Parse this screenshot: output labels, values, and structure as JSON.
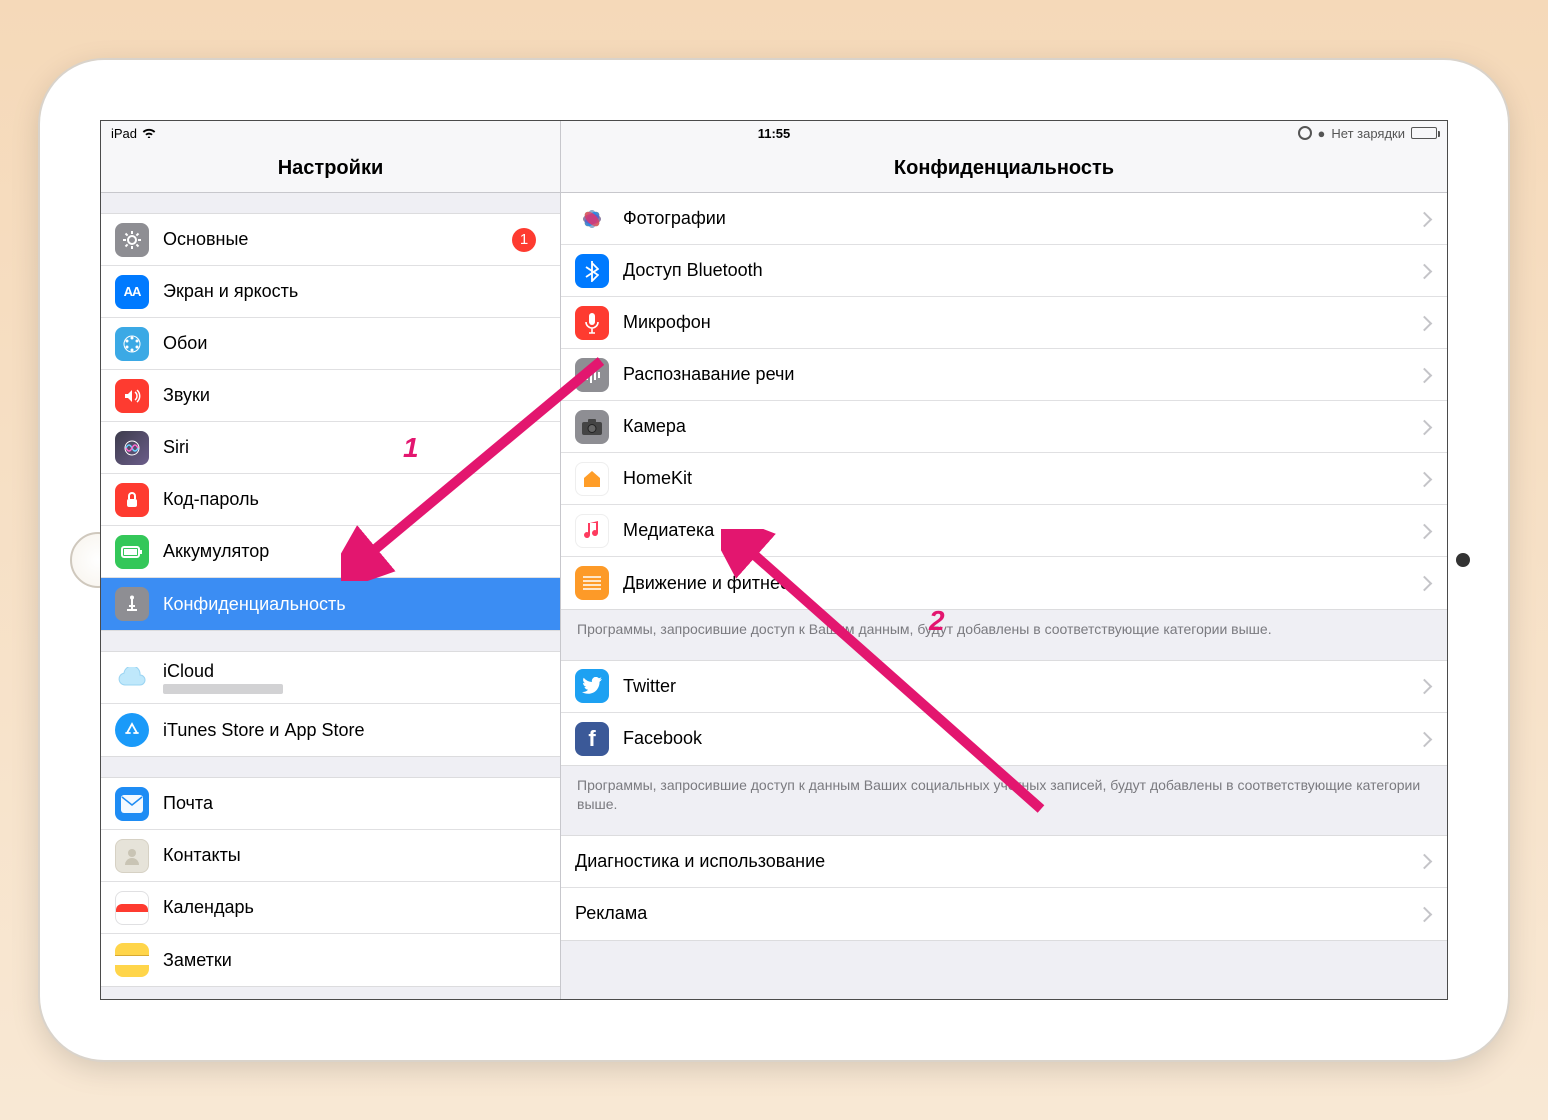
{
  "statusBar": {
    "device": "iPad",
    "time": "11:55",
    "chargingText": "Нет зарядки"
  },
  "sidebar": {
    "title": "Настройки",
    "groups": [
      {
        "items": [
          {
            "id": "general",
            "label": "Основные",
            "badge": "1"
          },
          {
            "id": "display",
            "label": "Экран и яркость"
          },
          {
            "id": "wallpaper",
            "label": "Обои"
          },
          {
            "id": "sounds",
            "label": "Звуки"
          },
          {
            "id": "siri",
            "label": "Siri"
          },
          {
            "id": "passcode",
            "label": "Код-пароль"
          },
          {
            "id": "battery",
            "label": "Аккумулятор"
          },
          {
            "id": "privacy",
            "label": "Конфиденциальность",
            "selected": true
          }
        ]
      },
      {
        "items": [
          {
            "id": "icloud",
            "label": "iCloud",
            "redacted": true
          },
          {
            "id": "appstore",
            "label": "iTunes Store и App Store"
          }
        ]
      },
      {
        "items": [
          {
            "id": "mail",
            "label": "Почта"
          },
          {
            "id": "contacts",
            "label": "Контакты"
          },
          {
            "id": "calendar",
            "label": "Календарь"
          },
          {
            "id": "notes",
            "label": "Заметки"
          }
        ]
      }
    ]
  },
  "detail": {
    "title": "Конфиденциальность",
    "groups": [
      {
        "flushTop": true,
        "items": [
          {
            "id": "photos",
            "label": "Фотографии"
          },
          {
            "id": "bluetooth",
            "label": "Доступ Bluetooth"
          },
          {
            "id": "mic",
            "label": "Микрофон"
          },
          {
            "id": "speech",
            "label": "Распознавание речи"
          },
          {
            "id": "camera",
            "label": "Камера"
          },
          {
            "id": "homekit",
            "label": "HomeKit"
          },
          {
            "id": "media",
            "label": "Медиатека"
          },
          {
            "id": "motion",
            "label": "Движение и фитнес"
          }
        ],
        "footer": "Программы, запросившие доступ к Вашим данным, будут добавлены в соответствующие категории выше."
      },
      {
        "items": [
          {
            "id": "twitter",
            "label": "Twitter"
          },
          {
            "id": "facebook",
            "label": "Facebook"
          }
        ],
        "footer": "Программы, запросившие доступ к данным Ваших социальных учетных записей, будут добавлены в соответствующие категории выше."
      },
      {
        "items": [
          {
            "id": "diag",
            "label": "Диагностика и использование",
            "noIcon": true
          },
          {
            "id": "ads",
            "label": "Реклама",
            "noIcon": true
          }
        ]
      }
    ]
  },
  "annotations": {
    "label1": "1",
    "label2": "2"
  }
}
